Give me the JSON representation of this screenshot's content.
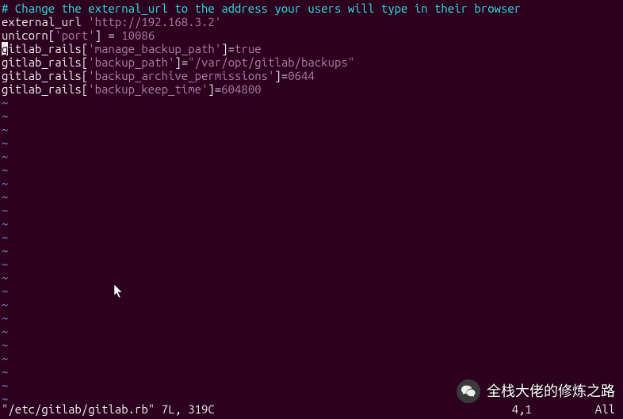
{
  "lines": {
    "l1_comment": "# Change the external_url to the address your users will type in their browser",
    "l2_pre": "external_url ",
    "l2_str": "'http://192.168.3.2'",
    "l3_pre": "unicorn[",
    "l3_key": "'port'",
    "l3_mid": "] = ",
    "l3_val": "10086",
    "l4_cursor": "g",
    "l4_pre": "itlab_rails[",
    "l4_key": "'manage_backup_path'",
    "l4_mid": "]=",
    "l4_val": "true",
    "l5_pre": "gitlab_rails[",
    "l5_key": "'backup_path'",
    "l5_mid": "]=",
    "l5_val": "\"/var/opt/gitlab/backups\"",
    "l6_pre": "gitlab_rails[",
    "l6_key": "'backup_archive_permissions'",
    "l6_mid": "]=",
    "l6_val": "0644",
    "l7_pre": "gitlab_rails[",
    "l7_key": "'backup_keep_time'",
    "l7_mid": "]=",
    "l7_val": "604800"
  },
  "tilde": "~",
  "status": {
    "file": "\"/etc/gitlab/gitlab.rb\" 7L, 319C",
    "pos": "4,1",
    "scroll": "All"
  },
  "watermark": {
    "text": "全栈大佬的修炼之路"
  }
}
